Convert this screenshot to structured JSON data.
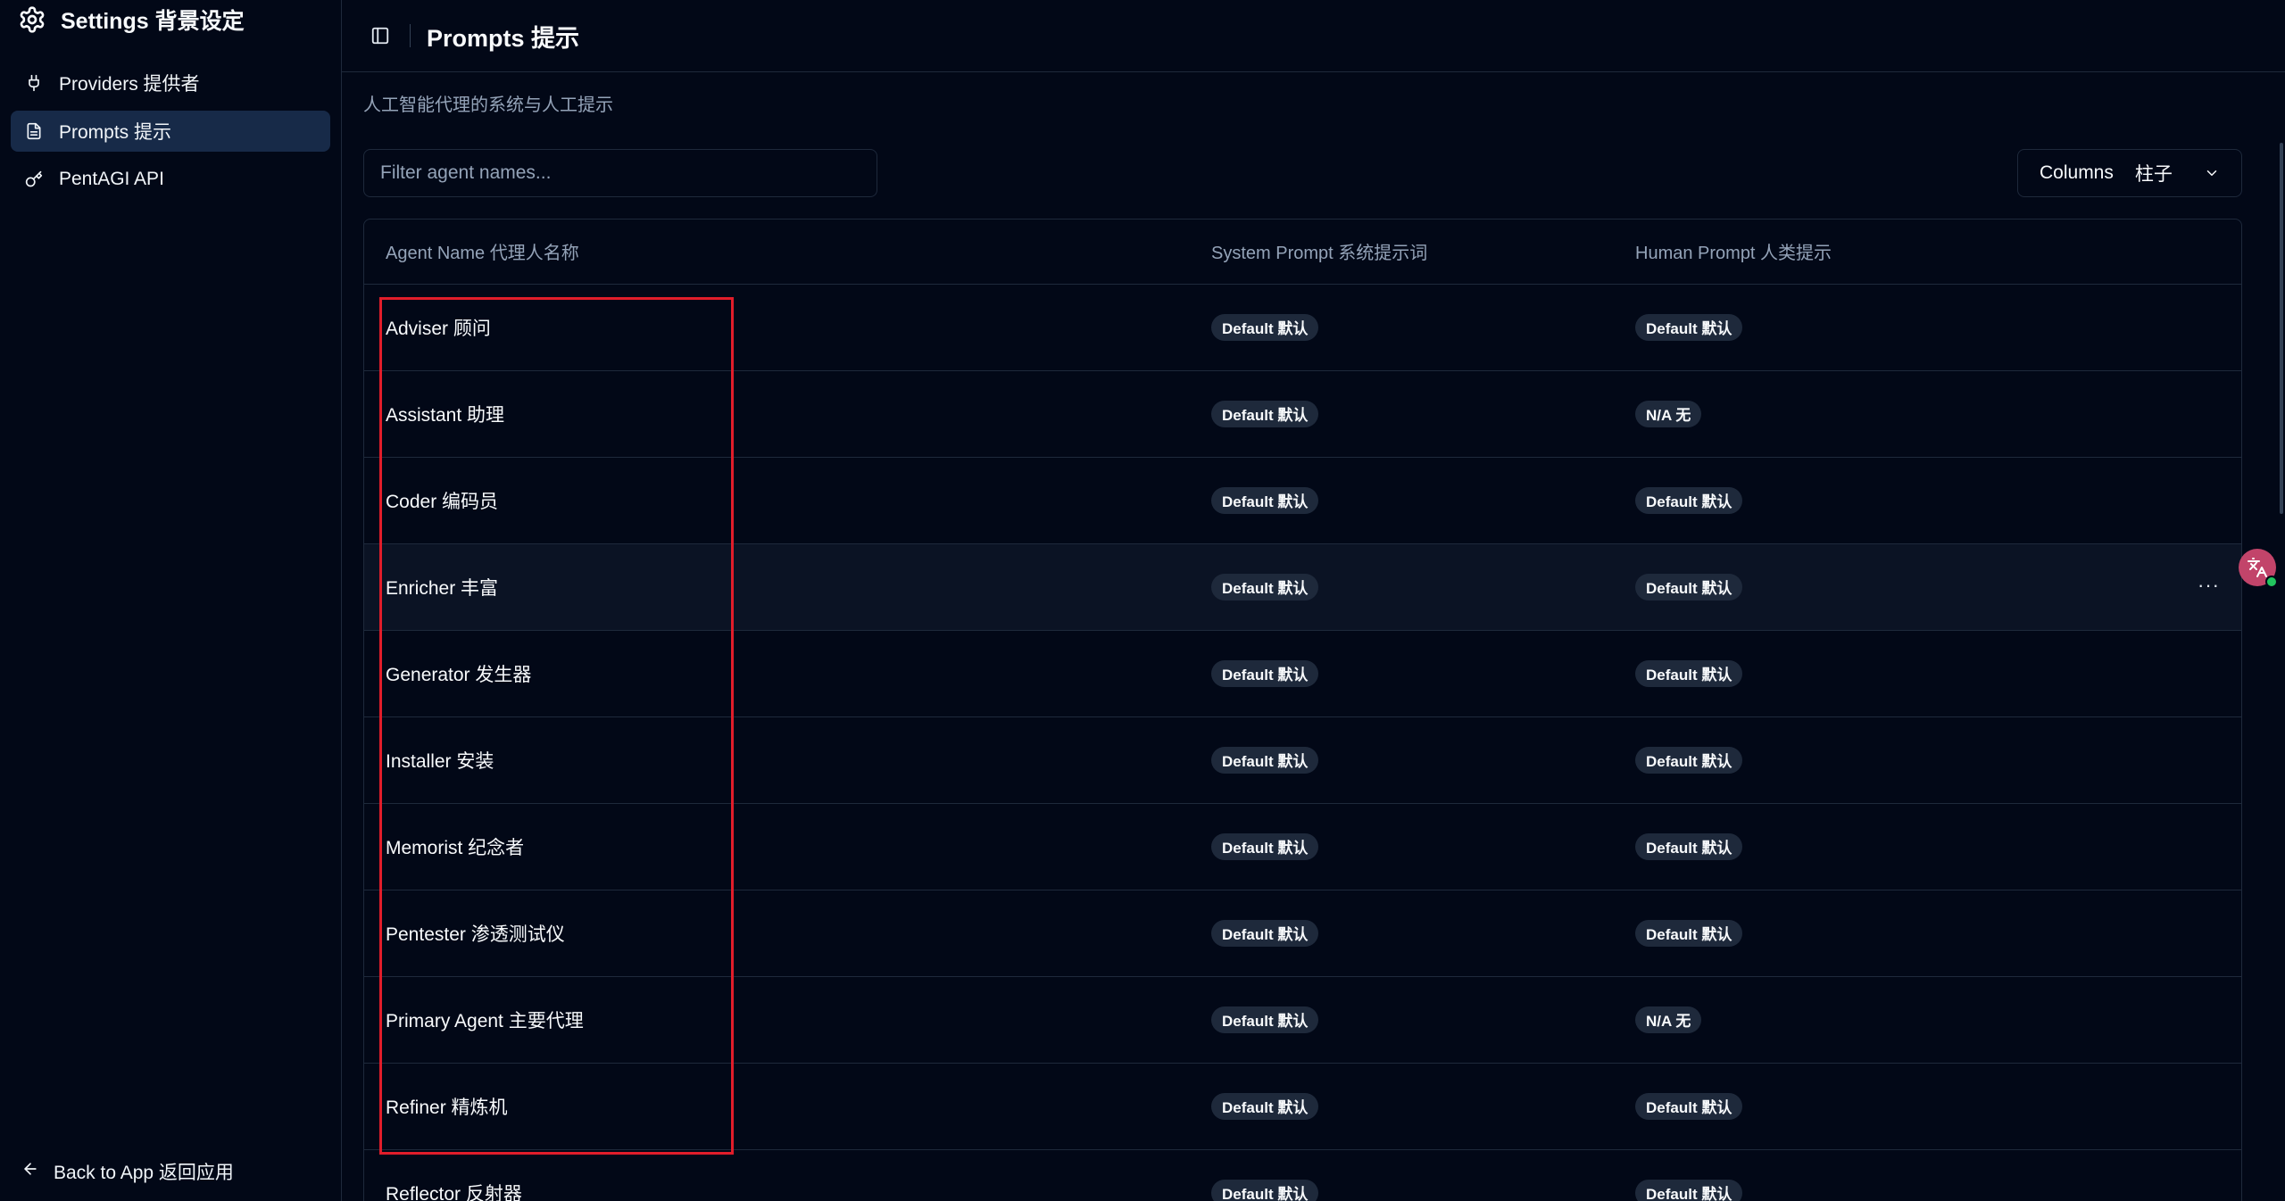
{
  "sidebar": {
    "title": "Settings 背景设定",
    "items": [
      {
        "label": "Providers 提供者",
        "icon": "plug-icon"
      },
      {
        "label": "Prompts 提示",
        "icon": "document-icon",
        "active": true
      },
      {
        "label": "PentAGI API",
        "icon": "key-icon"
      }
    ],
    "back_label": "Back to App 返回应用"
  },
  "header": {
    "title": "Prompts 提示"
  },
  "main": {
    "subtitle": "人工智能代理的系统与人工提示",
    "filter_placeholder": "Filter agent names...",
    "columns_label": "Columns",
    "columns_label_zh": "柱子"
  },
  "table": {
    "headers": [
      "Agent Name 代理人名称",
      "System Prompt 系统提示词",
      "Human Prompt 人类提示"
    ],
    "rows": [
      {
        "name": "Adviser 顾问",
        "system": "Default 默认",
        "human": "Default 默认"
      },
      {
        "name": "Assistant 助理",
        "system": "Default 默认",
        "human": "N/A 无"
      },
      {
        "name": "Coder 编码员",
        "system": "Default 默认",
        "human": "Default 默认"
      },
      {
        "name": "Enricher 丰富",
        "system": "Default 默认",
        "human": "Default 默认",
        "menu": "···"
      },
      {
        "name": "Generator 发生器",
        "system": "Default 默认",
        "human": "Default 默认"
      },
      {
        "name": "Installer 安装",
        "system": "Default 默认",
        "human": "Default 默认"
      },
      {
        "name": "Memorist 纪念者",
        "system": "Default 默认",
        "human": "Default 默认"
      },
      {
        "name": "Pentester 渗透测试仪",
        "system": "Default 默认",
        "human": "Default 默认"
      },
      {
        "name": "Primary Agent 主要代理",
        "system": "Default 默认",
        "human": "N/A 无"
      },
      {
        "name": "Refiner 精炼机",
        "system": "Default 默认",
        "human": "Default 默认"
      },
      {
        "name": "Reflector 反射器",
        "system": "Default 默认",
        "human": "Default 默认"
      }
    ]
  },
  "colors": {
    "background": "#020817",
    "highlight": "#e11d2a",
    "active_nav": "#172a48",
    "badge": "#1e293b"
  }
}
